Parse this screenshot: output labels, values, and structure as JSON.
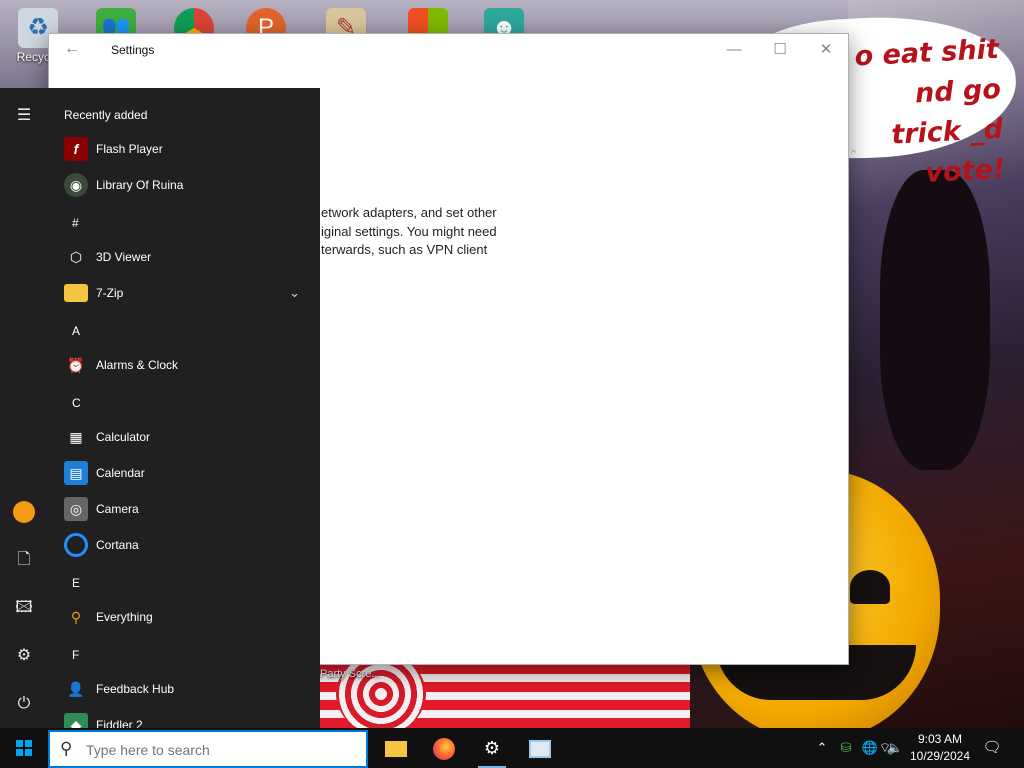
{
  "desktop": {
    "icons": [
      {
        "label": "Recycle",
        "icon": "recycle-bin-icon"
      },
      {
        "label": "",
        "icon": "users-icon"
      },
      {
        "label": "",
        "icon": "chrome-icon"
      },
      {
        "label": "",
        "icon": "app-icon"
      },
      {
        "label": "",
        "icon": "app-icon"
      },
      {
        "label": "",
        "icon": "microsoft-icon"
      },
      {
        "label": "",
        "icon": "avatar-icon"
      }
    ],
    "wallpaper_text": "o eat shit nd go trick _d vote!",
    "wallpaper_caption": "Party Scre..."
  },
  "settings_window": {
    "title": "Settings",
    "body_lines": [
      "etwork adapters, and set other",
      "iginal settings. You might need",
      "terwards, such as VPN client"
    ]
  },
  "start_menu": {
    "header": "Recently added",
    "recent": [
      {
        "label": "Flash Player",
        "icon": "flash-icon",
        "color": "#8b0000"
      },
      {
        "label": "Library Of Ruina",
        "icon": "library-of-ruina-icon",
        "color": "#3b4a3a"
      }
    ],
    "sections": [
      {
        "letter": "#",
        "apps": [
          {
            "label": "3D Viewer",
            "icon": "cube-icon",
            "color": "#202020"
          },
          {
            "label": "7-Zip",
            "icon": "folder-icon",
            "color": "#f5c542",
            "expandable": true
          }
        ]
      },
      {
        "letter": "A",
        "apps": [
          {
            "label": "Alarms & Clock",
            "icon": "clock-icon",
            "color": "#202020"
          }
        ]
      },
      {
        "letter": "C",
        "apps": [
          {
            "label": "Calculator",
            "icon": "calculator-icon",
            "color": "#202020"
          },
          {
            "label": "Calendar",
            "icon": "calendar-icon",
            "color": "#1e7fd6"
          },
          {
            "label": "Camera",
            "icon": "camera-icon",
            "color": "#666666"
          },
          {
            "label": "Cortana",
            "icon": "cortana-icon",
            "color": "#202020"
          }
        ]
      },
      {
        "letter": "E",
        "apps": [
          {
            "label": "Everything",
            "icon": "magnifier-icon",
            "color": "#202020"
          }
        ]
      },
      {
        "letter": "F",
        "apps": [
          {
            "label": "Feedback Hub",
            "icon": "feedback-icon",
            "color": "#202020"
          },
          {
            "label": "Fiddler 2",
            "icon": "fiddler-icon",
            "color": "#2e8b57"
          }
        ]
      }
    ],
    "rail": [
      "menu-icon",
      "user-avatar-icon",
      "documents-icon",
      "pictures-icon",
      "settings-icon",
      "power-icon"
    ]
  },
  "taskbar": {
    "search_placeholder": "Type here to search",
    "pinned": [
      "file-explorer-icon",
      "firefox-icon",
      "settings-icon",
      "app-window-icon"
    ],
    "tray": [
      "chevron-up-icon",
      "network-people-icon",
      "language-icon",
      "wifi-icon",
      "volume-icon"
    ],
    "time": "9:03 AM",
    "date": "10/29/2024"
  },
  "colors": {
    "accent": "#0078d7",
    "start_bg": "#202020",
    "taskbar_bg": "#101010",
    "wallpaper_text": "#b5121b"
  }
}
